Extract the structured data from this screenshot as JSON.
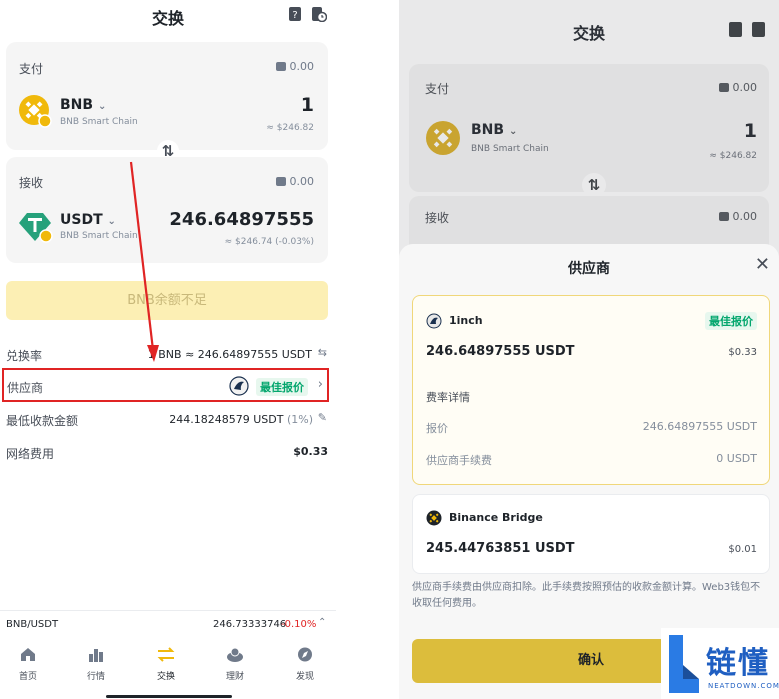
{
  "left": {
    "header": {
      "title": "交换"
    },
    "pay": {
      "label": "支付",
      "balance": "0.00",
      "token": "BNB",
      "chain": "BNB Smart Chain",
      "amount": "1",
      "fiat": "≈ $246.82"
    },
    "receive": {
      "label": "接收",
      "balance": "0.00",
      "token": "USDT",
      "chain": "BNB Smart Chain",
      "amount": "246.64897555",
      "fiat": "≈ $246.74 (-0.03%)"
    },
    "submit_label": "BNB余额不足",
    "rate": {
      "label": "兑换率",
      "value": "1 BNB ≈ 246.64897555 USDT"
    },
    "provider": {
      "label": "供应商",
      "badge": "最佳报价"
    },
    "min_receive": {
      "label": "最低收款金额",
      "value": "244.18248579 USDT",
      "pct": "(1%)"
    },
    "network_fee": {
      "label": "网络费用",
      "value": "$0.33"
    },
    "ticker": {
      "pair": "BNB/USDT",
      "price": "246.73333746",
      "change": "-0.10%"
    },
    "nav": [
      {
        "label": "首页",
        "icon": "home-icon"
      },
      {
        "label": "行情",
        "icon": "market-icon"
      },
      {
        "label": "交换",
        "icon": "swap-icon"
      },
      {
        "label": "理财",
        "icon": "earn-icon"
      },
      {
        "label": "发现",
        "icon": "discover-icon"
      }
    ]
  },
  "right": {
    "header": {
      "title": "交换"
    },
    "pay": {
      "label": "支付",
      "balance": "0.00",
      "token": "BNB",
      "chain": "BNB Smart Chain",
      "amount": "1",
      "fiat": "≈ $246.82"
    },
    "receive": {
      "label": "接收",
      "balance": "0.00"
    },
    "sheet": {
      "title": "供应商",
      "p1": {
        "name": "1inch",
        "badge": "最佳报价",
        "amount": "246.64897555 USDT",
        "fee": "$0.33",
        "details_title": "费率详情",
        "quote_label": "报价",
        "quote_value": "246.64897555 USDT",
        "provider_fee_label": "供应商手续费",
        "provider_fee_value": "0 USDT"
      },
      "p2": {
        "name": "Binance Bridge",
        "amount": "245.44763851 USDT",
        "fee": "$0.01"
      },
      "note": "供应商手续费由供应商扣除。此手续费按照预估的收款金额计算。Web3钱包不收取任何费用。",
      "confirm_label": "确认"
    }
  },
  "watermark": {
    "name": "链懂",
    "site": "NEATDOWN.COM"
  },
  "colors": {
    "brand_yellow": "#f0b90b",
    "green": "#03a66d",
    "red": "#e02424",
    "tether": "#26a17b"
  }
}
